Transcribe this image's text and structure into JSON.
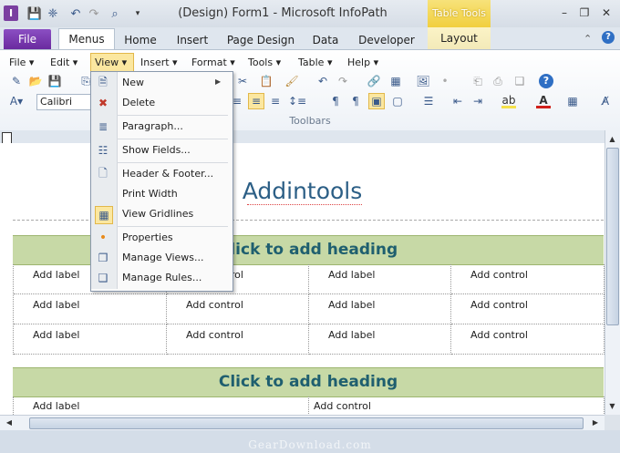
{
  "window": {
    "title": "(Design) Form1 - Microsoft InfoPath",
    "contextual_group": "Table Tools",
    "app_icon_letter": "I"
  },
  "ribbon_tabs": [
    "File",
    "Menus",
    "Home",
    "Insert",
    "Page Design",
    "Data",
    "Developer",
    "Layout"
  ],
  "menubar": [
    "File ▾",
    "Edit ▾",
    "View ▾",
    "Insert ▾",
    "Format ▾",
    "Tools ▾",
    "Table ▾",
    "Help ▾"
  ],
  "font_name": "Calibri",
  "group_label": "Toolbars",
  "view_menu": {
    "items": [
      {
        "label": "New",
        "icon": "new-doc-icon",
        "has_submenu": true
      },
      {
        "label": "Delete",
        "icon": "delete-view-icon"
      },
      {
        "label": "Paragraph...",
        "icon": "paragraph-icon"
      },
      {
        "label": "Show Fields...",
        "icon": "fields-icon"
      },
      {
        "label": "Header & Footer...",
        "icon": "header-footer-icon"
      },
      {
        "label": "Print Width",
        "icon": ""
      },
      {
        "label": "View Gridlines",
        "icon": "gridlines-icon"
      },
      {
        "label": "Properties",
        "icon": "bullet-icon"
      },
      {
        "label": "Manage Views...",
        "icon": "manage-views-icon"
      },
      {
        "label": "Manage Rules...",
        "icon": "manage-rules-icon"
      }
    ]
  },
  "form": {
    "title": "Addintools",
    "heading1": "Click to add heading",
    "heading2": "Click to add heading",
    "rows": [
      [
        "Add label",
        "Add control",
        "Add label",
        "Add control"
      ],
      [
        "Add label",
        "Add control",
        "Add label",
        "Add control"
      ],
      [
        "Add label",
        "Add control",
        "Add label",
        "Add control"
      ]
    ],
    "bottom_row": [
      "Add label",
      "Add control"
    ]
  },
  "watermark": "GearDownload.com",
  "colors": {
    "file_tab": "#6a2a9f",
    "table_tools": "#f1cf3e",
    "heading_band": "#c7d9a6",
    "heading_text": "#1f5f6f",
    "form_title": "#2c5f86",
    "menu_highlight": "#fbe7a0"
  }
}
